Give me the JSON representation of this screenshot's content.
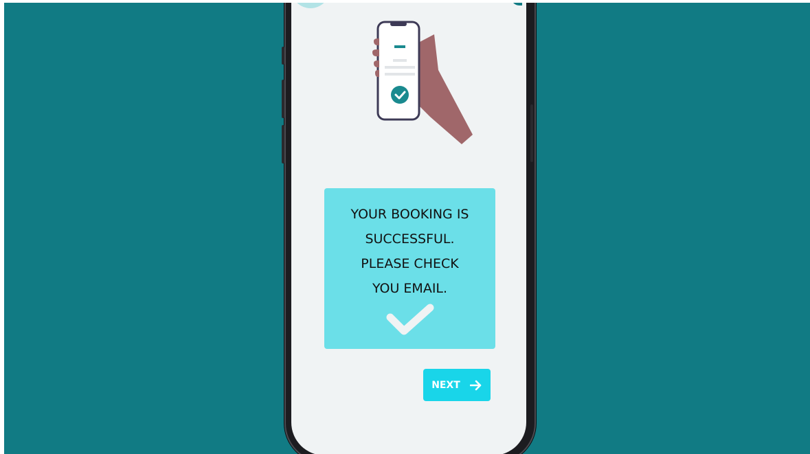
{
  "colors": {
    "background": "#117b84",
    "screen": "#f0f3f4",
    "card": "#6bdfe8",
    "button": "#19d5e9",
    "check": "#f0f3f4",
    "skin": "#a0676a",
    "phone_outline": "#3d3a56",
    "accent": "#1a8a8f"
  },
  "message": {
    "lines": [
      "YOUR BOOKING IS",
      "SUCCESSFUL.",
      "PLEASE CHECK",
      "YOU EMAIL."
    ]
  },
  "next_button": {
    "label": "NEXT",
    "icon": "arrow-right-icon"
  },
  "illustration": {
    "name": "hand-holding-phone",
    "icon": "check-circle-icon"
  }
}
